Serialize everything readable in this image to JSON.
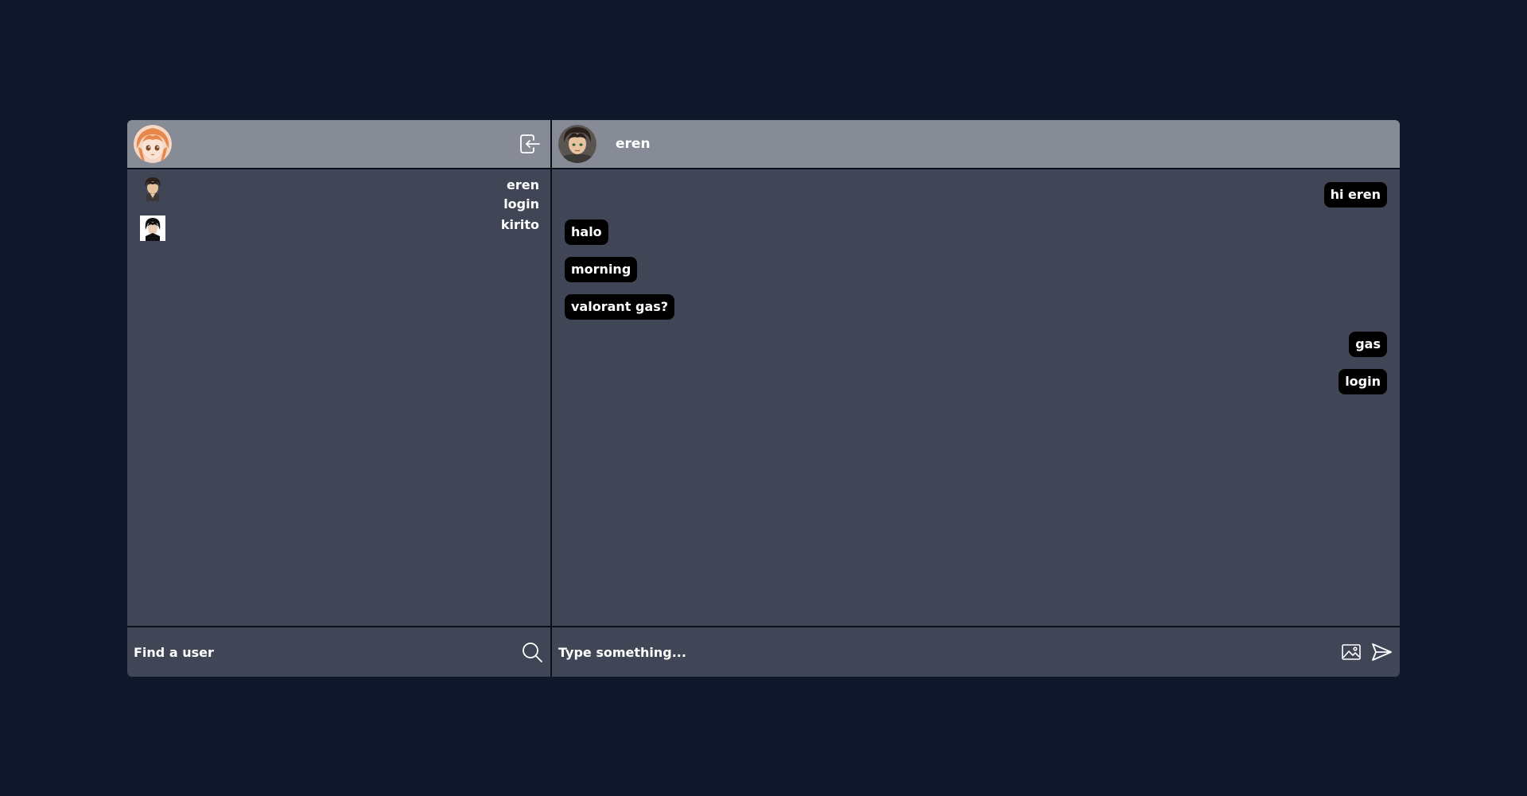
{
  "sidebar": {
    "current_user_avatar": "avatar-orange-hair",
    "logout_icon": "logout-icon",
    "users": [
      {
        "name": "eren",
        "last_message": "login",
        "avatar": "avatar-eren"
      },
      {
        "name": "kirito",
        "last_message": "",
        "avatar": "avatar-kirito"
      }
    ],
    "search": {
      "placeholder": "Find a user",
      "value": "",
      "icon": "search-icon"
    }
  },
  "chat": {
    "header": {
      "name": "eren",
      "avatar": "avatar-eren"
    },
    "messages": [
      {
        "text": "hi eren",
        "from": "me"
      },
      {
        "text": "halo",
        "from": "them"
      },
      {
        "text": "morning",
        "from": "them"
      },
      {
        "text": "valorant gas?",
        "from": "them"
      },
      {
        "text": "gas",
        "from": "me"
      },
      {
        "text": "login",
        "from": "me"
      }
    ],
    "composer": {
      "placeholder": "Type something...",
      "value": "",
      "image_icon": "image-icon",
      "send_icon": "send-icon"
    }
  },
  "colors": {
    "background": "#0f172a",
    "panel": "#404656",
    "header": "#878b95",
    "bubble": "#000000"
  }
}
